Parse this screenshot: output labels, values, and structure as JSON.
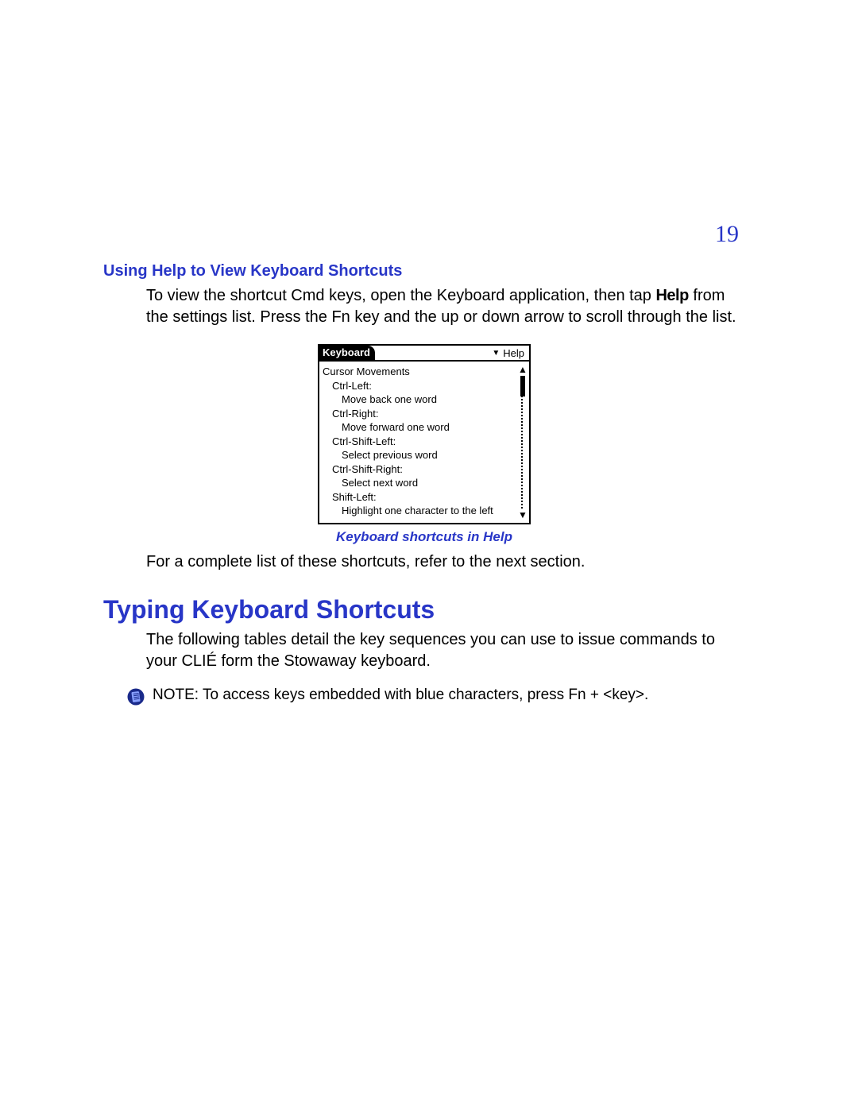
{
  "page_number": "19",
  "subhead": "Using Help to View Keyboard Shortcuts",
  "para1_a": "To view the shortcut Cmd keys, open the Keyboard application, then tap ",
  "para1_bold": "Help",
  "para1_b": " from the settings list. Press the Fn key and the up or down arrow to scroll through the list.",
  "palm": {
    "title_left": "Keyboard",
    "title_right": "Help",
    "section_title": "Cursor Movements",
    "items": [
      {
        "key": "Ctrl-Left:",
        "desc": "Move back one word"
      },
      {
        "key": "Ctrl-Right:",
        "desc": "Move forward one word"
      },
      {
        "key": "Ctrl-Shift-Left:",
        "desc": "Select previous word"
      },
      {
        "key": "Ctrl-Shift-Right:",
        "desc": "Select next word"
      },
      {
        "key": "Shift-Left:",
        "desc": "Highlight one character to the left"
      }
    ]
  },
  "figure_caption": "Keyboard shortcuts in Help",
  "para2": "For a complete list of these shortcuts, refer to the next section.",
  "section_heading": "Typing Keyboard Shortcuts",
  "para3": "The following tables detail the key sequences you can use to issue commands to your CLIÉ form the Stowaway keyboard.",
  "note": "NOTE: To access keys embedded with blue characters, press Fn + <key>."
}
